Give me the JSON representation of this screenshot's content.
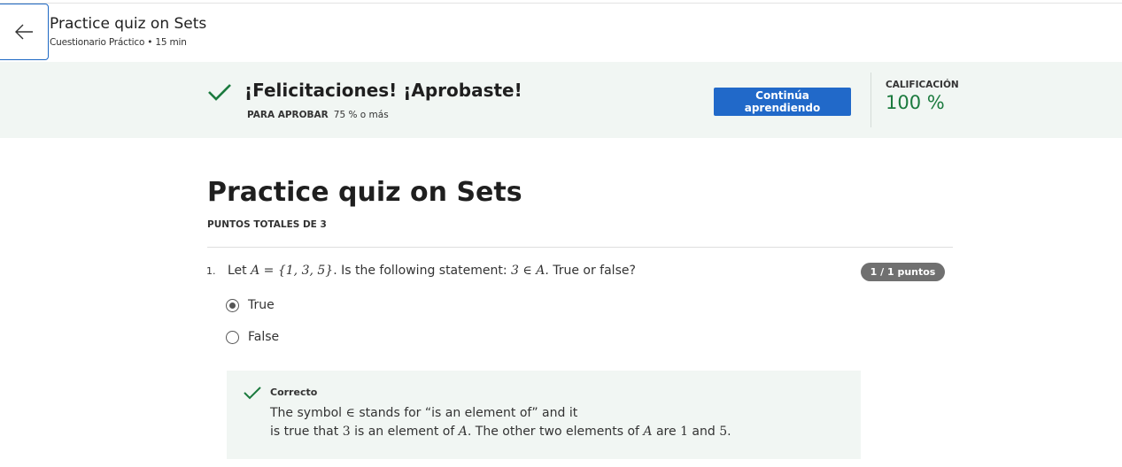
{
  "header": {
    "title": "Practice quiz on Sets",
    "subtitle": "Cuestionario Práctico • 15 min"
  },
  "banner": {
    "heading": "¡Felicitaciones! ¡Aprobaste!",
    "pass_label": "PARA APROBAR",
    "pass_value": "75 % o más",
    "continue_button": "Continúa aprendiendo",
    "grade_label": "CALIFICACIÓN",
    "grade_value": "100 %",
    "accent_color": "#1b7a3e",
    "button_color": "#2169c9"
  },
  "quiz": {
    "title": "Practice quiz on Sets",
    "total_points": "PUNTOS TOTALES DE 3",
    "questions": [
      {
        "number": "1.",
        "text_1": "Let ",
        "math_1": "A = {1, 3, 5}",
        "text_2": ". Is the following statement:  ",
        "math_2": "3 ∈ A.",
        "text_3": "  True or false?",
        "score": "1 / 1 puntos",
        "options": [
          {
            "label": "True",
            "selected": true
          },
          {
            "label": "False",
            "selected": false
          }
        ],
        "feedback": {
          "status": "Correcto",
          "line1_a": "The symbol ",
          "line1_sym": "∈",
          "line1_b": " stands for “is an element of” and it",
          "line2_a": "is true that ",
          "line2_n3": "3",
          "line2_b": " is an element of ",
          "line2_A1": "A",
          "line2_c": ". The other two elements of ",
          "line2_A2": "A",
          "line2_d": " are ",
          "line2_n1": "1",
          "line2_e": " and ",
          "line2_n5": "5",
          "line2_f": "."
        }
      }
    ]
  }
}
